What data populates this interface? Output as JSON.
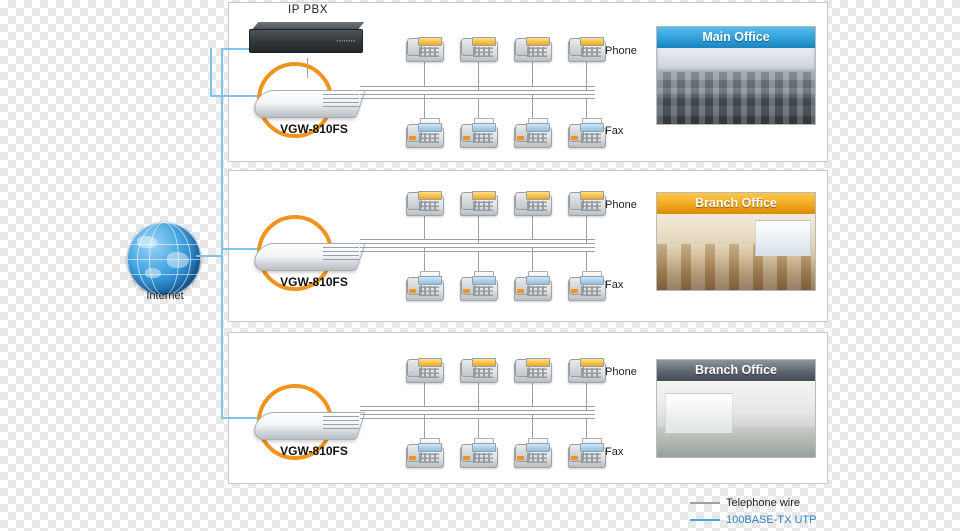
{
  "diagram": {
    "title": "VGW-810FS VoIP gateway deployment diagram",
    "internet": {
      "label": "Internet",
      "icon": "globe-icon"
    },
    "pbx": {
      "label": "IP PBX"
    },
    "legend": [
      {
        "label": "Telephone wire",
        "color": "#9aa0a6"
      },
      {
        "label": "100BASE-TX UTP",
        "color": "#2e7fc0"
      }
    ],
    "sites": [
      {
        "id": "main",
        "gateway_label": "VGW-810FS",
        "office_caption": "Main Office",
        "office_caption_color": "#2f9fd8",
        "phone_label": "Phone",
        "fax_label": "Fax",
        "phone_count": 4,
        "fax_count": 4
      },
      {
        "id": "branch1",
        "gateway_label": "VGW-810FS",
        "office_caption": "Branch Office",
        "office_caption_color": "#f0a81e",
        "phone_label": "Phone",
        "fax_label": "Fax",
        "phone_count": 4,
        "fax_count": 4
      },
      {
        "id": "branch2",
        "gateway_label": "VGW-810FS",
        "office_caption": "Branch Office",
        "office_caption_color": "#5d6570",
        "phone_label": "Phone",
        "fax_label": "Fax",
        "phone_count": 4,
        "fax_count": 4
      }
    ]
  }
}
